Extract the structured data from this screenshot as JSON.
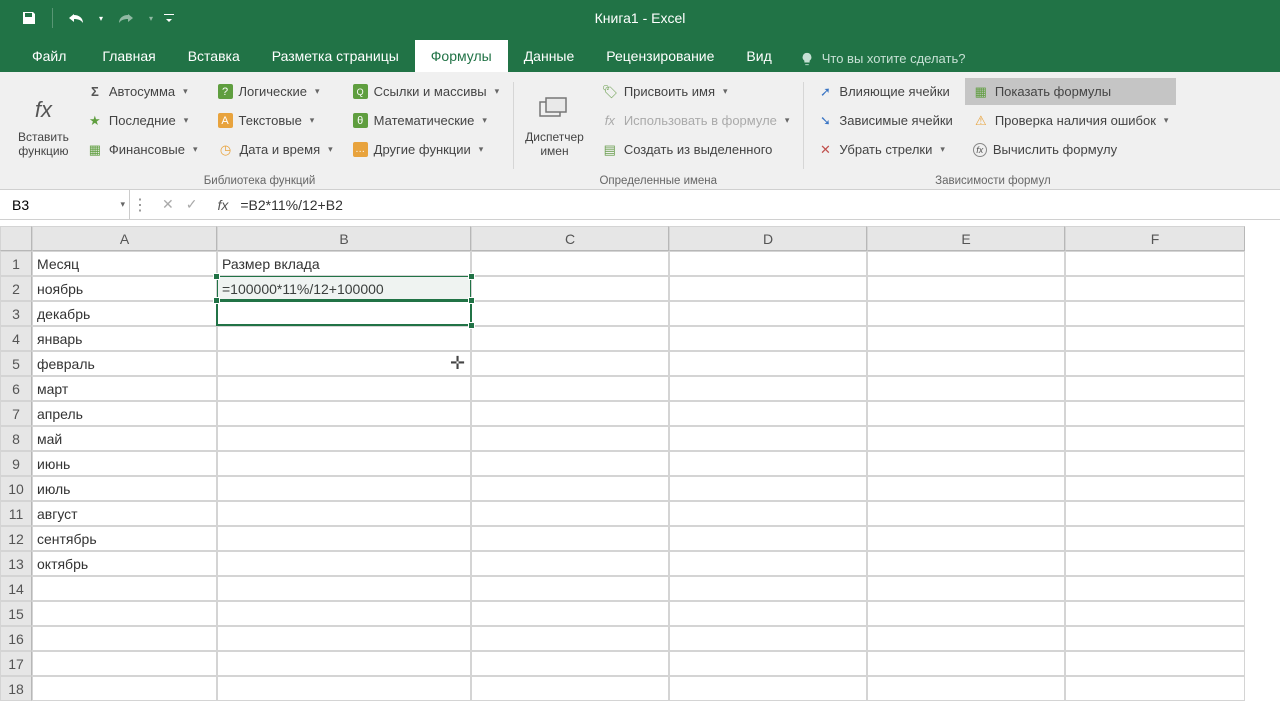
{
  "app": {
    "title": "Книга1 - Excel"
  },
  "qat": {
    "save": "save",
    "undo": "undo",
    "redo": "redo",
    "customize": "customize"
  },
  "tabs": {
    "file": "Файл",
    "items": [
      "Главная",
      "Вставка",
      "Разметка страницы",
      "Формулы",
      "Данные",
      "Рецензирование",
      "Вид"
    ],
    "active_index": 3,
    "tell_me": "Что вы хотите сделать?"
  },
  "ribbon": {
    "function_library": {
      "label": "Библиотека функций",
      "insert_fn_line1": "Вставить",
      "insert_fn_line2": "функцию",
      "autosum": "Автосумма",
      "recent": "Последние",
      "financial": "Финансовые",
      "logical": "Логические",
      "text": "Текстовые",
      "date_time": "Дата и время",
      "lookup": "Ссылки и массивы",
      "math": "Математические",
      "more": "Другие функции"
    },
    "defined_names": {
      "label": "Определенные имена",
      "name_mgr_line1": "Диспетчер",
      "name_mgr_line2": "имен",
      "define_name": "Присвоить имя",
      "use_in_formula": "Использовать в формуле",
      "create_from_sel": "Создать из выделенного"
    },
    "formula_auditing": {
      "label": "Зависимости формул",
      "trace_precedents": "Влияющие ячейки",
      "trace_dependents": "Зависимые ячейки",
      "remove_arrows": "Убрать стрелки",
      "show_formulas": "Показать формулы",
      "error_checking": "Проверка наличия ошибок",
      "evaluate": "Вычислить формулу"
    }
  },
  "formula_bar": {
    "namebox": "B3",
    "formula": "=B2*11%/12+B2"
  },
  "columns": [
    "A",
    "B",
    "C",
    "D",
    "E",
    "F"
  ],
  "rows": [
    1,
    2,
    3,
    4,
    5,
    6,
    7,
    8,
    9,
    10,
    11,
    12,
    13,
    14,
    15,
    16,
    17,
    18
  ],
  "data": {
    "A1": "Месяц",
    "B1": "Размер вклада",
    "A2": "ноябрь",
    "B2": "=100000*11%/12+100000",
    "A3": "декабрь",
    "B3_prefix": "=",
    "B3_ref1": "B2",
    "B3_mid": "*11%/12+",
    "B3_ref2": "B2",
    "A4": "январь",
    "A5": "февраль",
    "A6": "март",
    "A7": "апрель",
    "A8": "май",
    "A9": "июнь",
    "A10": "июль",
    "A11": "август",
    "A12": "сентябрь",
    "A13": "октябрь"
  }
}
